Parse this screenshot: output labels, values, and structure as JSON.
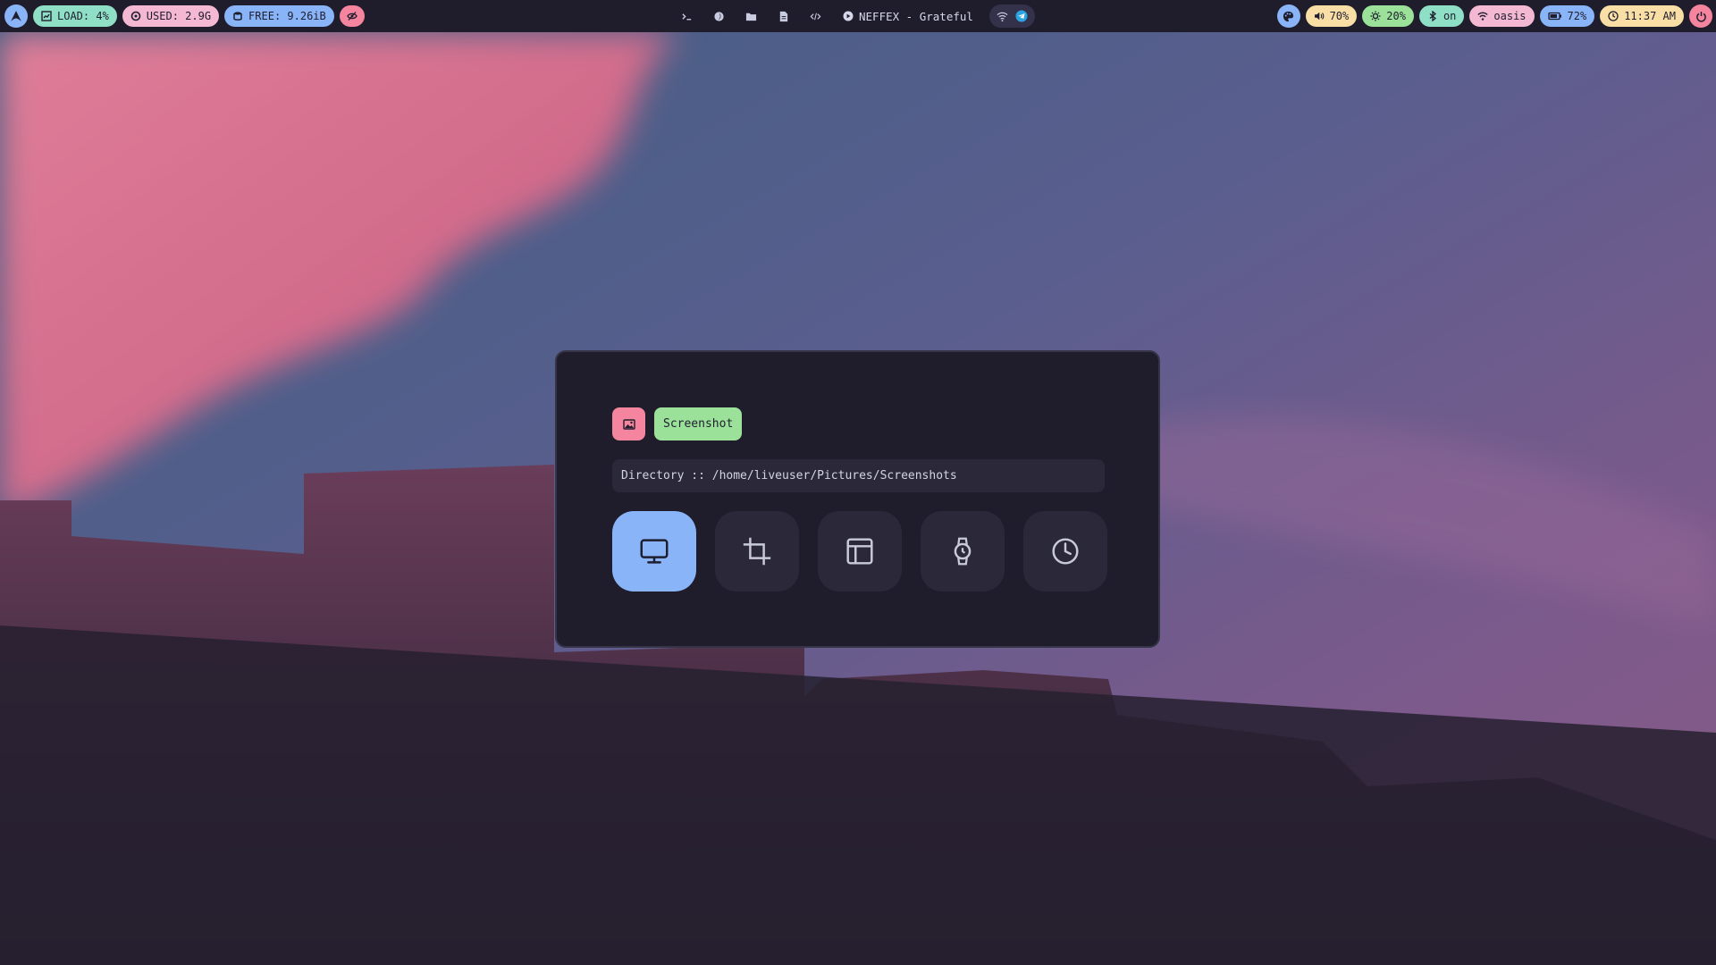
{
  "bar": {
    "left": {
      "launcher": {
        "icon": "arch-logo-icon",
        "color": "#8ab4f8"
      },
      "load": {
        "label": "LOAD: 4%",
        "icon": "chart-icon",
        "color": "#8fdfc6"
      },
      "used": {
        "label": "USED: 2.9G",
        "icon": "memory-icon",
        "color": "#f4b8d2"
      },
      "free": {
        "label": "FREE: 9.26iB",
        "icon": "disk-icon",
        "color": "#8ab4f8"
      },
      "eye": {
        "icon": "eye-slash-icon",
        "color": "#f5849e"
      }
    },
    "center": {
      "icons": [
        "terminal-icon",
        "browser-icon",
        "folder-icon",
        "file-icon",
        "code-icon"
      ],
      "music": {
        "label": "NEFFEX - Grateful",
        "icon": "play-icon"
      },
      "tray": [
        "wifi-icon",
        "telegram-icon"
      ]
    },
    "right": {
      "theme": {
        "icon": "palette-icon",
        "color": "#8ab4f8"
      },
      "volume": {
        "label": "70%",
        "icon": "volume-icon",
        "color": "#f9dfa6"
      },
      "brightness": {
        "label": "20%",
        "icon": "brightness-icon",
        "color": "#9be19a"
      },
      "bluetooth": {
        "label": "on",
        "icon": "bluetooth-icon",
        "color": "#8fdfc6"
      },
      "network": {
        "label": "oasis",
        "icon": "wifi-icon",
        "color": "#f4b8d2"
      },
      "battery": {
        "label": "72%",
        "icon": "battery-icon",
        "color": "#8ab4f8"
      },
      "clock": {
        "label": "11:37 AM",
        "icon": "clock-icon",
        "color": "#f9dfa6"
      },
      "power": {
        "icon": "power-icon",
        "color": "#f5849e"
      }
    }
  },
  "dialog": {
    "icon": "image-icon",
    "title": "Screenshot",
    "directory": "Directory :: /home/liveuser/Pictures/Screenshots",
    "modes": [
      {
        "name": "Full Screen",
        "icon": "monitor-icon",
        "active": true
      },
      {
        "name": "Area",
        "icon": "crop-icon",
        "active": false
      },
      {
        "name": "Window",
        "icon": "window-layout-icon",
        "active": false
      },
      {
        "name": "Timer",
        "icon": "stopwatch-icon",
        "active": false
      },
      {
        "name": "Delay",
        "icon": "clock-icon",
        "active": false
      }
    ],
    "accent": "#8ab4f8"
  }
}
